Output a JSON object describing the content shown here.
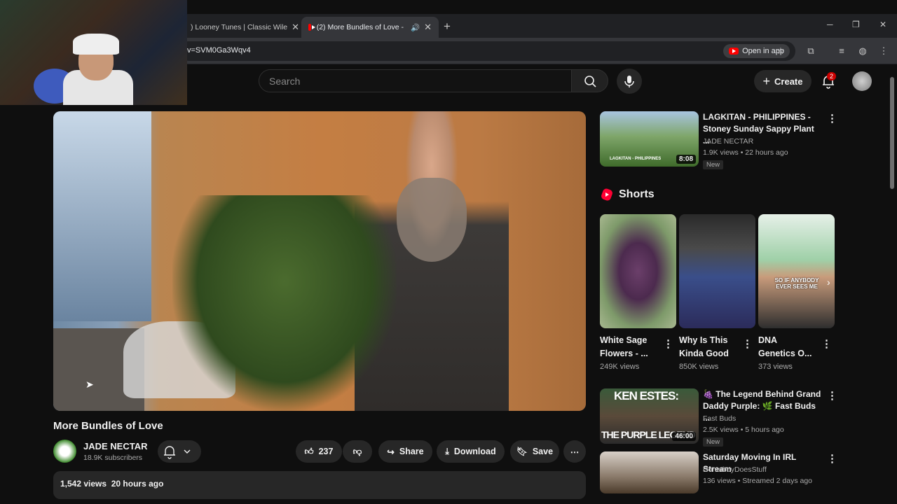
{
  "browser": {
    "tabs": [
      {
        "label": ") Looney Tunes | Classic Wile",
        "active": false
      },
      {
        "label": "(2) More Bundles of Love -",
        "active": true
      }
    ],
    "url": "v=SVM0Ga3Wqv4",
    "open_in_app": "Open in app"
  },
  "header": {
    "search_placeholder": "Search",
    "create_label": "Create",
    "notification_count": "2"
  },
  "video": {
    "title": "More Bundles of Love",
    "channel": "JADE NECTAR",
    "subscribers": "18.9K subscribers",
    "likes": "237",
    "share": "Share",
    "download": "Download",
    "save": "Save",
    "views": "1,542 views",
    "age": "20 hours ago"
  },
  "related": [
    {
      "title_1": "LAGKITAN - PHILIPPINES -",
      "title_2": "Stoney Sunday Sappy Plant ...",
      "channel": "JADE NECTAR",
      "meta": "1.9K views • 22 hours ago",
      "duration": "8:08",
      "tag": "New",
      "thumb_text": "LAGKITAN - PHILIPPINES"
    },
    {
      "title_1": "🍇 The Legend Behind Grand",
      "title_2": "Daddy Purple: 🌿 Fast Buds ...",
      "channel": "Fast Buds",
      "meta": "2.5K views • 5 hours ago",
      "duration": "46:00",
      "tag": "New",
      "thumb_top": "KEN ESTES:",
      "thumb_bottom": "THE PURPLE LEGEND"
    },
    {
      "title_1": "Saturday Moving In IRL Stream",
      "channel": "DonutboyDoesStuff",
      "meta": "136 views • Streamed 2 days ago"
    }
  ],
  "shorts": {
    "heading": "Shorts",
    "items": [
      {
        "line1": "White Sage",
        "line2": "Flowers - ...",
        "views": "249K views"
      },
      {
        "line1": "Why Is This",
        "line2": "Kinda Good",
        "views": "850K views"
      },
      {
        "line1": "DNA",
        "line2": "Genetics  O...",
        "views": "373 views",
        "caption": "SO IF ANYBODY EVER SEES ME"
      }
    ]
  },
  "colors": {
    "accent": "#ff0000",
    "background": "#0f0f0f",
    "chip": "#272727"
  }
}
